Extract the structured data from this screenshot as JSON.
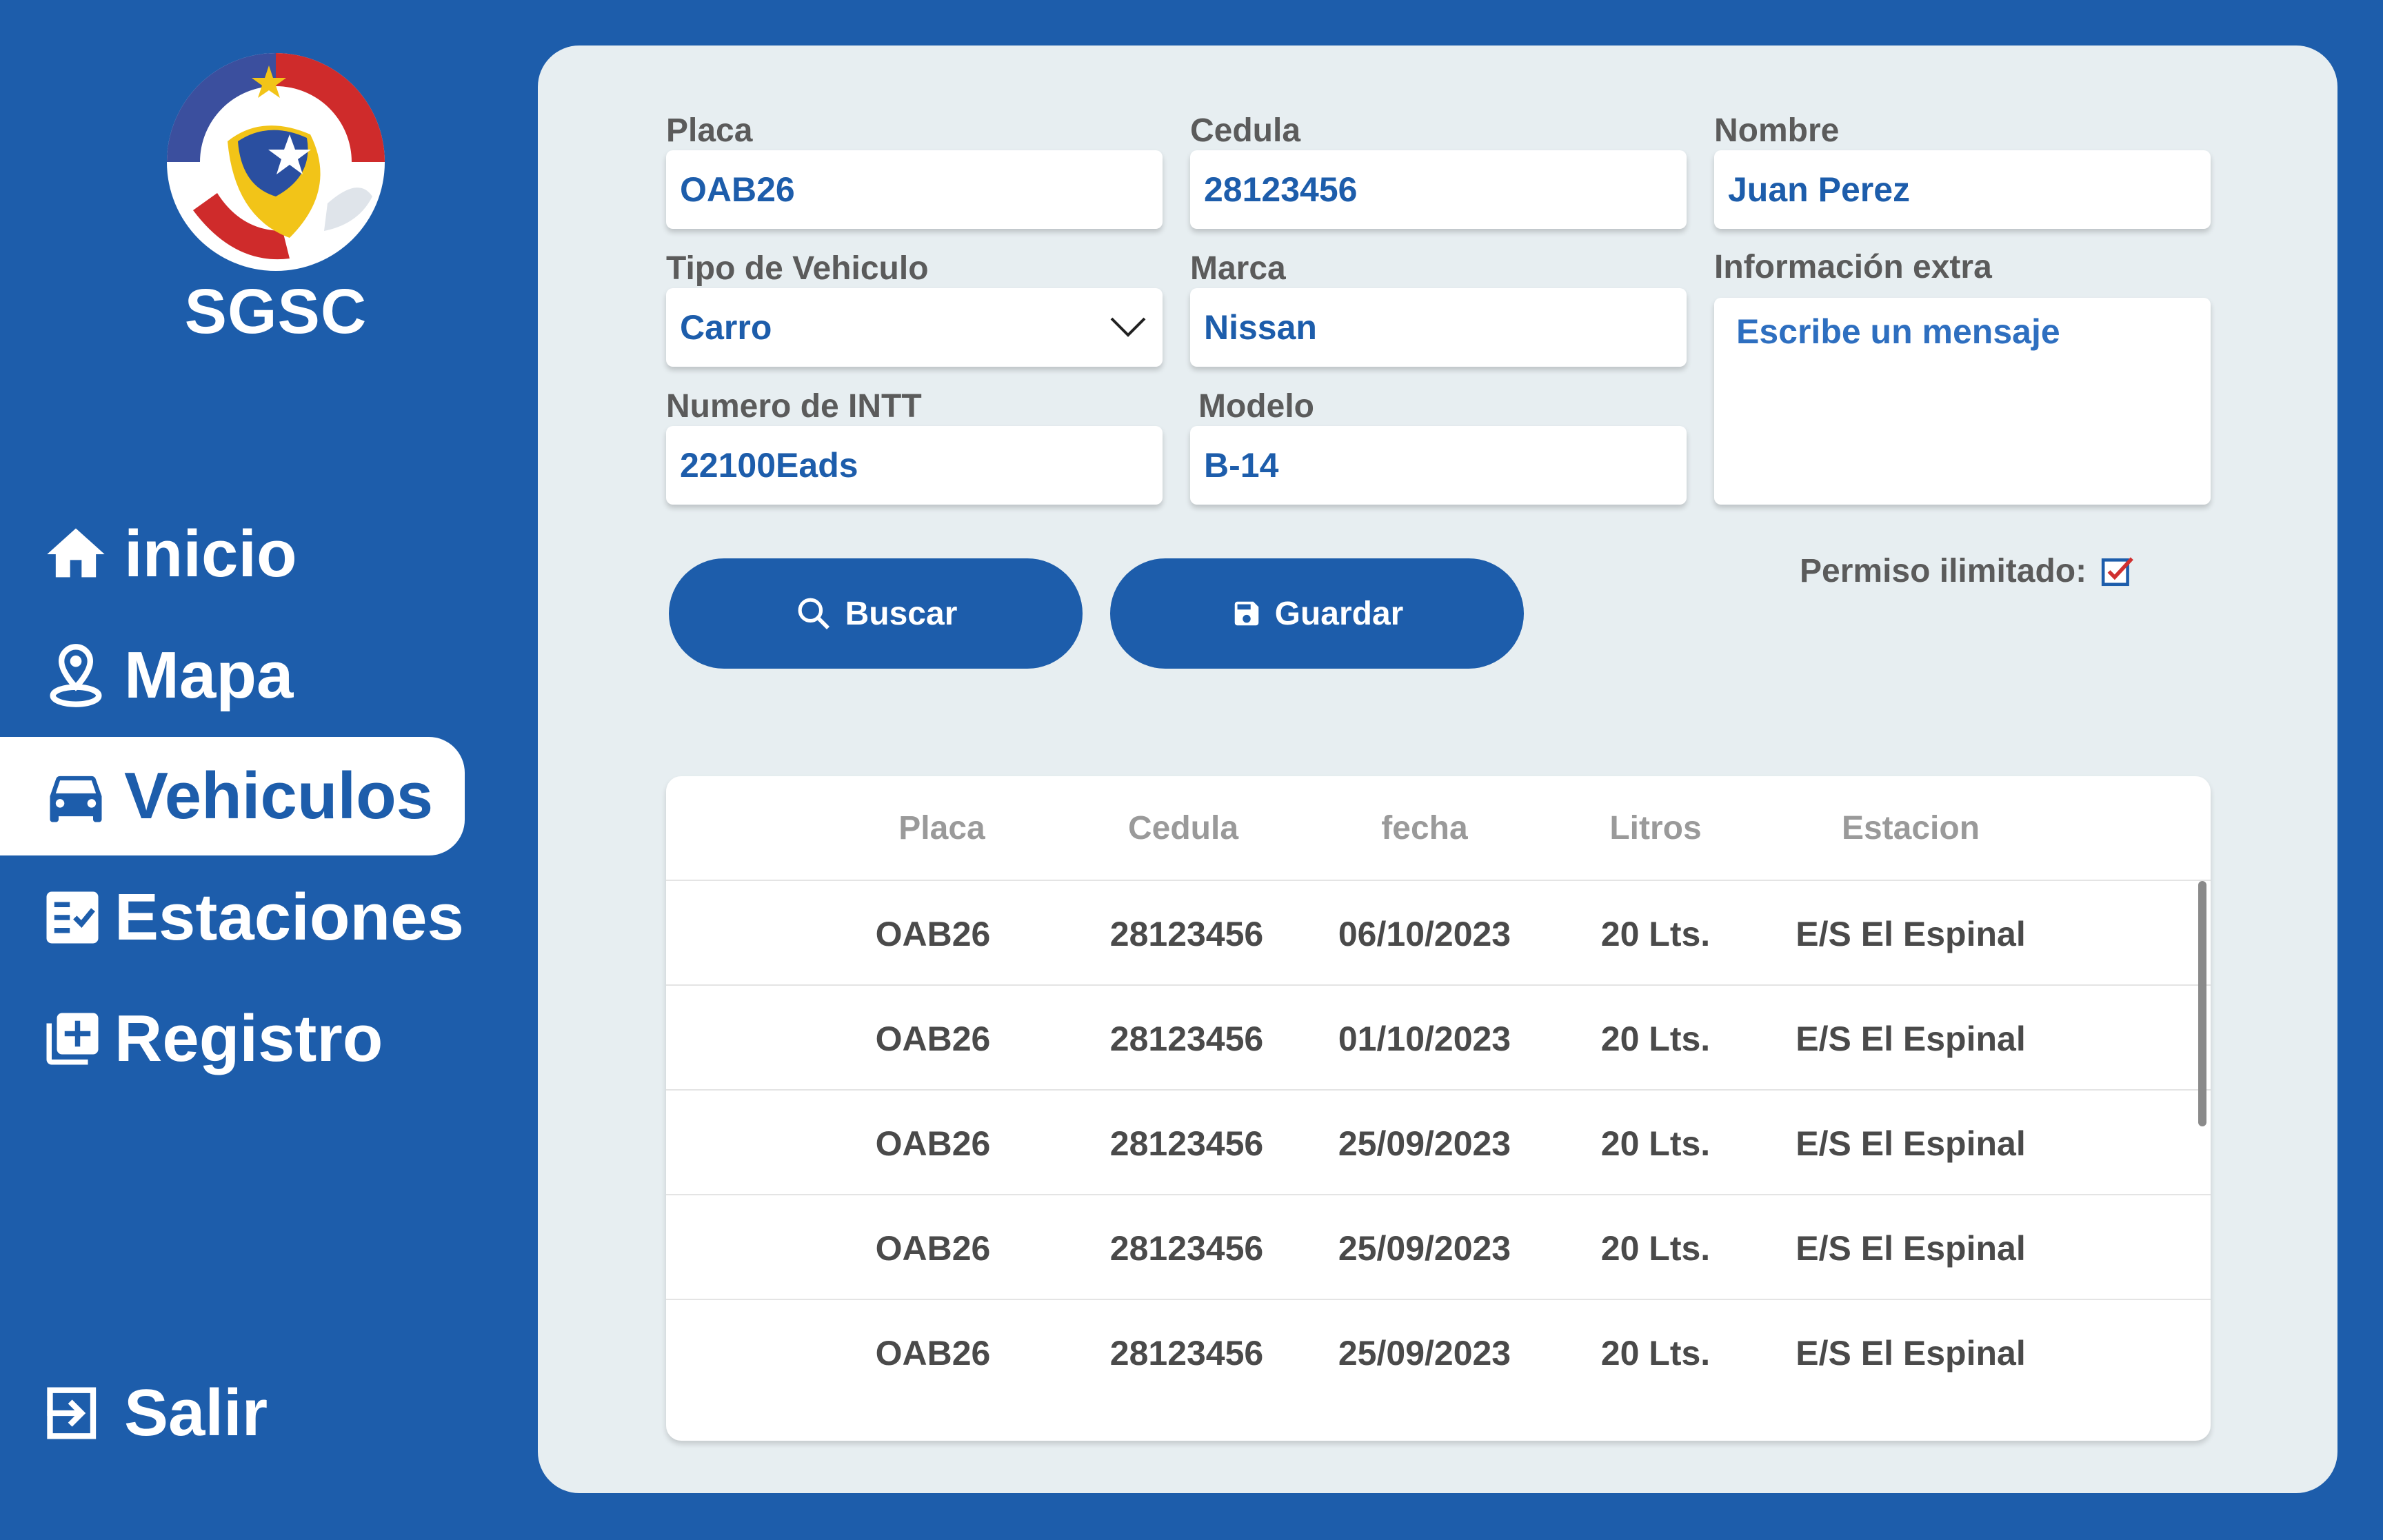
{
  "app": {
    "brand": "SGSC"
  },
  "nav": {
    "items": [
      {
        "label": "inicio",
        "icon": "home-icon"
      },
      {
        "label": "Mapa",
        "icon": "map-pin-icon"
      },
      {
        "label": "Vehiculos",
        "icon": "car-icon",
        "active": true
      },
      {
        "label": "Estaciones",
        "icon": "checklist-icon"
      },
      {
        "label": "Registro",
        "icon": "add-box-icon"
      }
    ],
    "logout": {
      "label": "Salir",
      "icon": "logout-icon"
    }
  },
  "form": {
    "placa": {
      "label": "Placa",
      "value": "OAB26"
    },
    "cedula": {
      "label": "Cedula",
      "value": "28123456"
    },
    "nombre": {
      "label": "Nombre",
      "value": "Juan Perez"
    },
    "tipo": {
      "label": "Tipo de Vehiculo",
      "value": "Carro"
    },
    "marca": {
      "label": "Marca",
      "value": "Nissan"
    },
    "extra": {
      "label": "Información extra",
      "placeholder": "Escribe un mensaje"
    },
    "intt": {
      "label": "Numero de INTT",
      "value": "22100Eads"
    },
    "modelo": {
      "label": "Modelo",
      "value": "B-14"
    },
    "permiso": {
      "label": "Permiso ilimitado:",
      "checked": true
    }
  },
  "buttons": {
    "buscar": "Buscar",
    "guardar": "Guardar"
  },
  "table": {
    "headers": [
      "Placa",
      "Cedula",
      "fecha",
      "Litros",
      "Estacion"
    ],
    "rows": [
      [
        "OAB26",
        "28123456",
        "06/10/2023",
        "20 Lts.",
        "E/S El Espinal"
      ],
      [
        "OAB26",
        "28123456",
        "01/10/2023",
        "20 Lts.",
        "E/S El Espinal"
      ],
      [
        "OAB26",
        "28123456",
        "25/09/2023",
        "20 Lts.",
        "E/S El Espinal"
      ],
      [
        "OAB26",
        "28123456",
        "25/09/2023",
        "20 Lts.",
        "E/S El Espinal"
      ],
      [
        "OAB26",
        "28123456",
        "25/09/2023",
        "20 Lts.",
        "E/S El Espinal"
      ]
    ]
  },
  "colors": {
    "primary": "#1d5dab",
    "panel": "#e7eef1",
    "check_accent": "#d03030"
  }
}
